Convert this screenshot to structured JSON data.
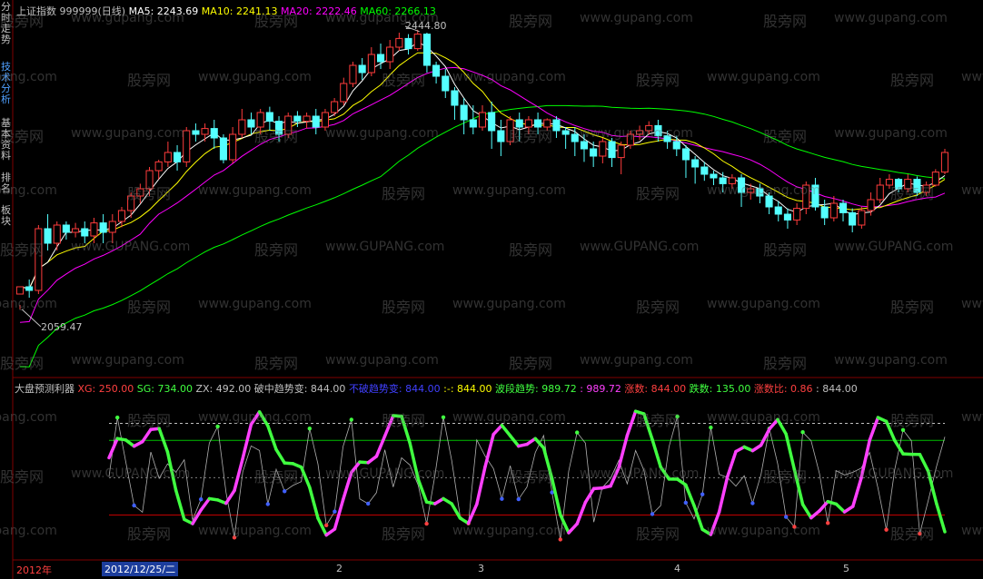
{
  "main_header": {
    "index_name": "上证指数",
    "index_code": "999999(日线)",
    "ma5": "MA5: 2243.69",
    "ma10": "MA10: 2241.13",
    "ma20": "MA20: 2222.46",
    "ma60": "MA60: 2266.13"
  },
  "side_tabs": [
    "分时走势",
    "技术分析",
    "基本资料",
    "排名",
    "板块"
  ],
  "annotations": {
    "high": "2444.80",
    "low": "2059.47"
  },
  "indicator_header": {
    "name": "大盘预测利器",
    "xg": "XG: 250.00",
    "sg": "SG: 734.00",
    "zx": "ZX: 492.00",
    "pzqsb": "破中趋势变: 844.00",
    "bbqsb": "不破趋势变: 844.00",
    "sep": ":-: 844.00",
    "bdqs": "波段趋势: 989.72",
    "bdqs2": ": 989.72",
    "zs": "涨数: 844.00",
    "ds": "跌数: 135.00",
    "zsb": "涨数比: 0.86",
    "last": ": 844.00"
  },
  "x_axis": {
    "year": "2012年",
    "cursor_date": "2012/12/25/二",
    "months": [
      "2",
      "3",
      "4",
      "5"
    ]
  },
  "watermark": {
    "cn": "股旁网",
    "url": "www.gupang.com",
    "url_caps": "www.GUPANG.com"
  },
  "colors": {
    "up": "#ff3c3c",
    "down": "#54ffff",
    "ma5": "#ffffff",
    "ma10": "#ffff00",
    "ma20": "#ff00ff",
    "ma60": "#00ff00",
    "text": "#c0c0c0"
  },
  "chart_data": {
    "type": "candlestick",
    "title": "上证指数 999999(日线)",
    "ylim": [
      2020,
      2460
    ],
    "candles": [
      [
        2080,
        2090,
        2065,
        2059
      ],
      [
        2090,
        2085,
        2100,
        2075
      ],
      [
        2085,
        2170,
        2175,
        2080
      ],
      [
        2170,
        2150,
        2190,
        2140
      ],
      [
        2150,
        2175,
        2180,
        2140
      ],
      [
        2175,
        2165,
        2180,
        2155
      ],
      [
        2165,
        2170,
        2178,
        2158
      ],
      [
        2170,
        2160,
        2180,
        2150
      ],
      [
        2160,
        2178,
        2185,
        2150
      ],
      [
        2178,
        2165,
        2190,
        2150
      ],
      [
        2165,
        2180,
        2190,
        2150
      ],
      [
        2180,
        2195,
        2200,
        2172
      ],
      [
        2195,
        2215,
        2220,
        2185
      ],
      [
        2215,
        2225,
        2232,
        2205
      ],
      [
        2225,
        2250,
        2255,
        2215
      ],
      [
        2250,
        2262,
        2265,
        2238
      ],
      [
        2262,
        2275,
        2290,
        2255
      ],
      [
        2275,
        2262,
        2285,
        2250
      ],
      [
        2262,
        2305,
        2310,
        2255
      ],
      [
        2305,
        2300,
        2315,
        2290
      ],
      [
        2300,
        2308,
        2315,
        2290
      ],
      [
        2308,
        2295,
        2320,
        2280
      ],
      [
        2295,
        2265,
        2300,
        2260
      ],
      [
        2265,
        2300,
        2310,
        2260
      ],
      [
        2300,
        2320,
        2335,
        2295
      ],
      [
        2320,
        2310,
        2330,
        2300
      ],
      [
        2310,
        2330,
        2335,
        2300
      ],
      [
        2330,
        2318,
        2338,
        2305
      ],
      [
        2318,
        2300,
        2325,
        2290
      ],
      [
        2300,
        2325,
        2330,
        2295
      ],
      [
        2325,
        2318,
        2332,
        2310
      ],
      [
        2318,
        2325,
        2330,
        2308
      ],
      [
        2325,
        2310,
        2335,
        2300
      ],
      [
        2310,
        2330,
        2335,
        2305
      ],
      [
        2330,
        2345,
        2350,
        2325
      ],
      [
        2345,
        2370,
        2378,
        2340
      ],
      [
        2370,
        2395,
        2400,
        2365
      ],
      [
        2395,
        2385,
        2405,
        2375
      ],
      [
        2385,
        2410,
        2420,
        2380
      ],
      [
        2410,
        2400,
        2425,
        2390
      ],
      [
        2400,
        2420,
        2430,
        2390
      ],
      [
        2420,
        2432,
        2440,
        2415
      ],
      [
        2432,
        2418,
        2438,
        2410
      ],
      [
        2418,
        2438,
        2444,
        2415
      ],
      [
        2438,
        2395,
        2440,
        2385
      ],
      [
        2395,
        2380,
        2400,
        2370
      ],
      [
        2380,
        2360,
        2390,
        2350
      ],
      [
        2360,
        2340,
        2365,
        2320
      ],
      [
        2340,
        2320,
        2350,
        2300
      ],
      [
        2320,
        2310,
        2340,
        2300
      ],
      [
        2310,
        2330,
        2340,
        2305
      ],
      [
        2330,
        2305,
        2345,
        2280
      ],
      [
        2305,
        2290,
        2320,
        2270
      ],
      [
        2290,
        2320,
        2325,
        2285
      ],
      [
        2320,
        2310,
        2330,
        2290
      ],
      [
        2310,
        2320,
        2325,
        2300
      ],
      [
        2320,
        2310,
        2330,
        2300
      ],
      [
        2310,
        2320,
        2322,
        2305
      ],
      [
        2320,
        2305,
        2325,
        2295
      ],
      [
        2305,
        2300,
        2310,
        2280
      ],
      [
        2300,
        2290,
        2310,
        2270
      ],
      [
        2290,
        2280,
        2300,
        2262
      ],
      [
        2280,
        2270,
        2290,
        2255
      ],
      [
        2270,
        2290,
        2295,
        2260
      ],
      [
        2290,
        2268,
        2295,
        2255
      ],
      [
        2268,
        2285,
        2290,
        2245
      ],
      [
        2285,
        2300,
        2305,
        2280
      ],
      [
        2300,
        2305,
        2312,
        2292
      ],
      [
        2305,
        2312,
        2318,
        2300
      ],
      [
        2312,
        2298,
        2320,
        2290
      ],
      [
        2298,
        2290,
        2305,
        2280
      ],
      [
        2290,
        2280,
        2298,
        2270
      ],
      [
        2280,
        2265,
        2285,
        2240
      ],
      [
        2265,
        2255,
        2270,
        2232
      ],
      [
        2255,
        2245,
        2262,
        2236
      ],
      [
        2245,
        2240,
        2250,
        2230
      ],
      [
        2240,
        2232,
        2248,
        2220
      ],
      [
        2232,
        2240,
        2245,
        2225
      ],
      [
        2240,
        2220,
        2245,
        2200
      ],
      [
        2220,
        2225,
        2232,
        2210
      ],
      [
        2225,
        2215,
        2232,
        2205
      ],
      [
        2215,
        2200,
        2220,
        2190
      ],
      [
        2200,
        2190,
        2208,
        2180
      ],
      [
        2190,
        2182,
        2198,
        2170
      ],
      [
        2182,
        2198,
        2205,
        2175
      ],
      [
        2198,
        2230,
        2235,
        2190
      ],
      [
        2230,
        2200,
        2240,
        2195
      ],
      [
        2200,
        2185,
        2210,
        2175
      ],
      [
        2185,
        2205,
        2215,
        2180
      ],
      [
        2205,
        2192,
        2210,
        2180
      ],
      [
        2192,
        2175,
        2198,
        2165
      ],
      [
        2175,
        2195,
        2200,
        2170
      ],
      [
        2195,
        2210,
        2220,
        2188
      ],
      [
        2210,
        2230,
        2240,
        2205
      ],
      [
        2230,
        2238,
        2245,
        2225
      ],
      [
        2238,
        2225,
        2240,
        2220
      ],
      [
        2225,
        2238,
        2245,
        2220
      ],
      [
        2238,
        2220,
        2242,
        2215
      ],
      [
        2220,
        2230,
        2235,
        2215
      ],
      [
        2230,
        2248,
        2252,
        2228
      ],
      [
        2248,
        2275,
        2280,
        2245
      ]
    ],
    "indicator": {
      "ylim": [
        0,
        1000
      ],
      "levels": {
        "XG": 250,
        "SG": 734,
        "ZX": 492
      }
    }
  }
}
